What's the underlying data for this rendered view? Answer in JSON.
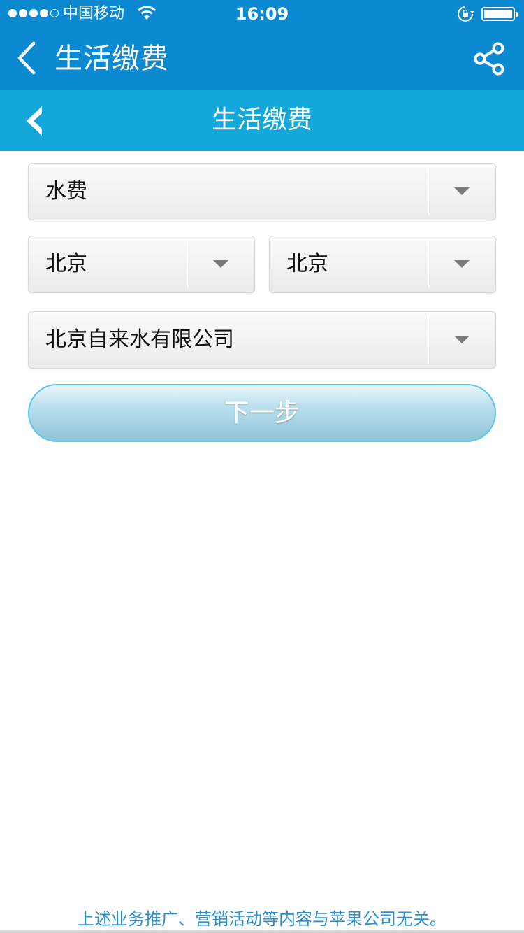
{
  "status_bar": {
    "carrier": "中国移动",
    "time": "16:09",
    "icons": [
      "signal-dots",
      "wifi-icon",
      "orientation-lock-icon",
      "battery-icon"
    ]
  },
  "nav_bar": {
    "title": "生活缴费",
    "icons": [
      "chevron-left-icon",
      "share-icon"
    ]
  },
  "sub_header": {
    "title": "生活缴费",
    "icons": [
      "chevron-left-icon"
    ]
  },
  "form": {
    "type_select": "水费",
    "province_select": "北京",
    "city_select": "北京",
    "company_select": "北京自来水有限公司",
    "next_label": "下一步"
  },
  "footer": {
    "disclaimer": "上述业务推广、营销活动等内容与苹果公司无关。"
  },
  "colors": {
    "nav_bg": "#0b8ad2",
    "sub_header_bg": "#14a8da",
    "footer_text": "#2d8fd0"
  }
}
